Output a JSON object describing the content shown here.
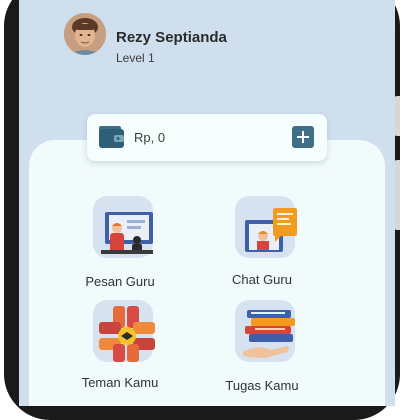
{
  "user": {
    "name": "Rezy Septianda",
    "level": "Level 1"
  },
  "wallet": {
    "balance": "Rp, 0"
  },
  "menu": [
    {
      "id": "pesan-guru",
      "label": "Pesan Guru",
      "icon": "teacher-lesson-icon"
    },
    {
      "id": "chat-guru",
      "label": "Chat Guru",
      "icon": "teacher-chat-icon"
    },
    {
      "id": "teman-kamu",
      "label": "Teman Kamu",
      "icon": "teamwork-hands-icon"
    },
    {
      "id": "tugas-kamu",
      "label": "Tugas Kamu",
      "icon": "books-stack-icon"
    }
  ],
  "colors": {
    "header_bg": "#cfdfee",
    "panel_bg": "#f2fbfb",
    "accent": "#3f6f86"
  }
}
